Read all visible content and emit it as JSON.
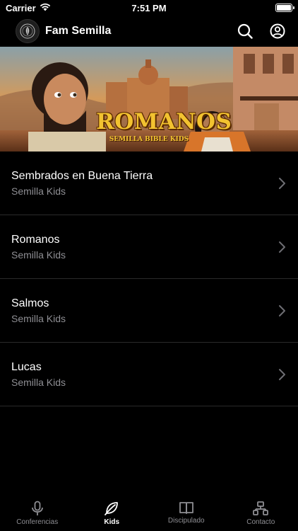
{
  "status_bar": {
    "carrier": "Carrier",
    "time": "7:51 PM"
  },
  "header": {
    "title": "Fam Semilla"
  },
  "banner": {
    "title": "ROMANOS",
    "subtitle": "SEMILLA BIBLE KIDS"
  },
  "list": [
    {
      "title": "Sembrados en Buena Tierra",
      "subtitle": "Semilla Kids"
    },
    {
      "title": "Romanos",
      "subtitle": "Semilla Kids"
    },
    {
      "title": "Salmos",
      "subtitle": "Semilla Kids"
    },
    {
      "title": "Lucas",
      "subtitle": "Semilla Kids"
    }
  ],
  "tabs": [
    {
      "label": "Conferencias",
      "icon": "microphone-icon",
      "active": false
    },
    {
      "label": "Kids",
      "icon": "leaf-icon",
      "active": true
    },
    {
      "label": "Discipulado",
      "icon": "book-icon",
      "active": false
    },
    {
      "label": "Contacto",
      "icon": "network-icon",
      "active": false
    }
  ],
  "colors": {
    "background": "#000000",
    "secondary_text": "#8e8e93",
    "banner_title": "#f2c230"
  }
}
